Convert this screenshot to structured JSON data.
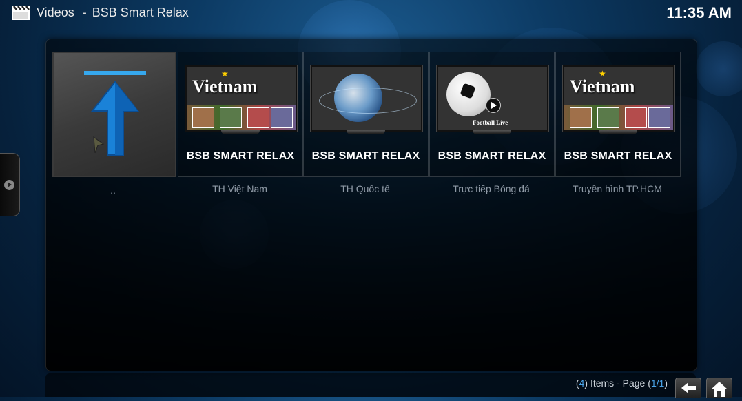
{
  "header": {
    "section": "Videos",
    "separator": "-",
    "subsection": "BSB Smart Relax",
    "clock": "11:35 AM"
  },
  "items": [
    {
      "type": "parent",
      "label": ".."
    },
    {
      "type": "folder",
      "thumb": "vietnam",
      "thumb_text": "Vietnam",
      "title": "BSB SMART RELAX",
      "label": "TH Việt Nam"
    },
    {
      "type": "folder",
      "thumb": "globe",
      "title": "BSB SMART RELAX",
      "label": "TH Quốc tế"
    },
    {
      "type": "folder",
      "thumb": "football",
      "thumb_text": "Football Live",
      "title": "BSB SMART RELAX",
      "label": "Trực tiếp Bóng đá"
    },
    {
      "type": "folder",
      "thumb": "vietnam",
      "thumb_text": "Vietnam",
      "title": "BSB SMART RELAX",
      "label": "Truyền hình TP.HCM"
    }
  ],
  "footer": {
    "open_paren": "(",
    "count": "4",
    "items_text": ") Items - Page (",
    "page": "1/1",
    "close_paren": ")"
  },
  "icons": {
    "app": "clapperboard-icon",
    "back": "back-arrow-icon",
    "home": "home-icon",
    "side": "side-menu-arrow-icon",
    "parent": "up-arrow-icon"
  },
  "colors": {
    "accent": "#4aa3e8",
    "label": "#8f9aa6"
  }
}
